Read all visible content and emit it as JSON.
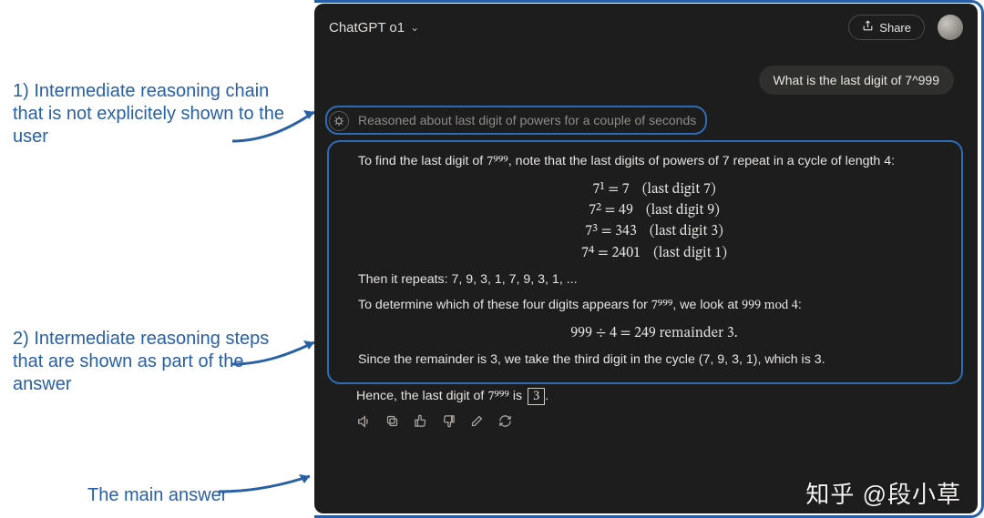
{
  "annotations": {
    "label1": "1) Intermediate reasoning chain that is not explicitely shown to the user",
    "label2": "2) Intermediate reasoning steps that are shown as part of the answer",
    "label3": "The main answer"
  },
  "topbar": {
    "model": "ChatGPT o1",
    "share": "Share"
  },
  "user_message": "What is the last digit of 7^999",
  "reasoning_summary": "Reasoned about last digit of powers for a couple of seconds",
  "answer": {
    "intro_a": "To find the last digit of ",
    "intro_math": "7⁹⁹⁹",
    "intro_b": ", note that the last digits of powers of 7 repeat in a cycle of length 4:",
    "rows": [
      {
        "lhs": "7¹ = 7",
        "hint": "(last digit 7)"
      },
      {
        "lhs": "7² = 49",
        "hint": "(last digit 9)"
      },
      {
        "lhs": "7³ = 343",
        "hint": "(last digit 3)"
      },
      {
        "lhs": "7⁴ = 2401",
        "hint": "(last digit 1)"
      }
    ],
    "repeat": "Then it repeats: 7, 9, 3, 1, 7, 9, 3, 1, ...",
    "det_a": "To determine which of these four digits appears for ",
    "det_math": "7⁹⁹⁹",
    "det_b": ", we look at ",
    "det_mod": "999 mod 4",
    "det_c": ":",
    "division": "999 ÷ 4 = 249 remainder 3.",
    "since": "Since the remainder is 3, we take the third digit in the cycle (7, 9, 3, 1), which is 3.",
    "final_a": "Hence, the last digit of ",
    "final_math": "7⁹⁹⁹",
    "final_b": " is ",
    "final_boxed": "3",
    "final_c": "."
  },
  "watermark": "知乎 @段小草",
  "icons": {
    "share": "share-icon",
    "chevron": "chevron-down-icon",
    "audio": "audio-icon",
    "copy": "copy-icon",
    "thumbs_up": "thumbs-up-icon",
    "thumbs_down": "thumbs-down-icon",
    "edit": "edit-icon",
    "regen": "regenerate-icon"
  }
}
